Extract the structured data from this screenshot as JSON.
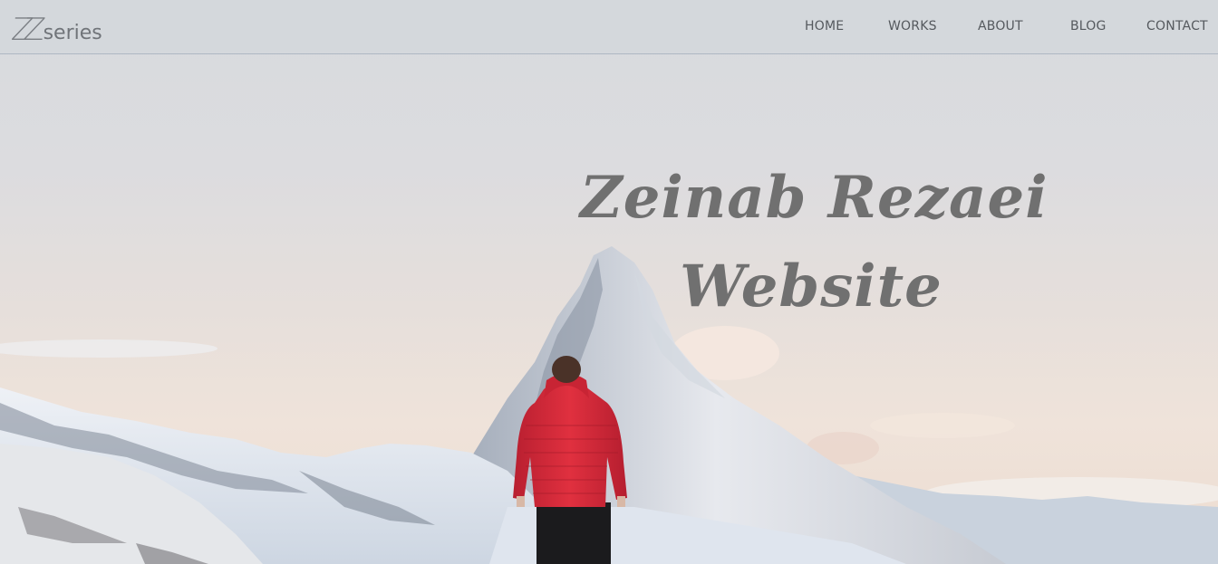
{
  "logo": {
    "mark": "ZZ",
    "text": "series"
  },
  "nav": {
    "items": [
      {
        "label": "HOME"
      },
      {
        "label": "WORKS"
      },
      {
        "label": "ABOUT"
      },
      {
        "label": "BLOG"
      },
      {
        "label": "CONTACT"
      }
    ]
  },
  "hero": {
    "title_line1": "Zeinab Rezaei",
    "title_line2": "Website"
  },
  "colors": {
    "jacket": "#d4283a",
    "title": "#707070",
    "nav_text": "#55595e"
  }
}
